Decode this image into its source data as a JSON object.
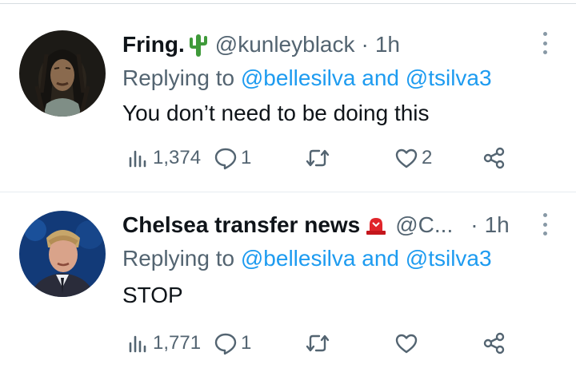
{
  "tweets": [
    {
      "name": "Fring.",
      "emoji": "cactus-icon",
      "handle": "@kunleyblack",
      "separator": "·",
      "time": "1h",
      "replying_prefix": "Replying to",
      "mention_1": "@bellesilva",
      "mention_joiner": "and",
      "mention_2": "@tsilva3",
      "text": "You don’t need to be doing this",
      "views": "1,374",
      "replies": "1",
      "retweets": "",
      "likes": "2"
    },
    {
      "name": "Chelsea transfer news",
      "emoji": "siren-icon",
      "handle": "@C...",
      "separator": "·",
      "time": "1h",
      "replying_prefix": "Replying to",
      "mention_1": "@bellesilva",
      "mention_joiner": "and",
      "mention_2": "@tsilva3",
      "text": "STOP",
      "views": "1,771",
      "replies": "1",
      "retweets": "",
      "likes": ""
    }
  ],
  "colors": {
    "text": "#0f1419",
    "secondary": "#536471",
    "link": "#1d9bf0",
    "divider": "#e6ecf0",
    "cactus": "#3f9a3a",
    "siren": "#e0252b"
  }
}
